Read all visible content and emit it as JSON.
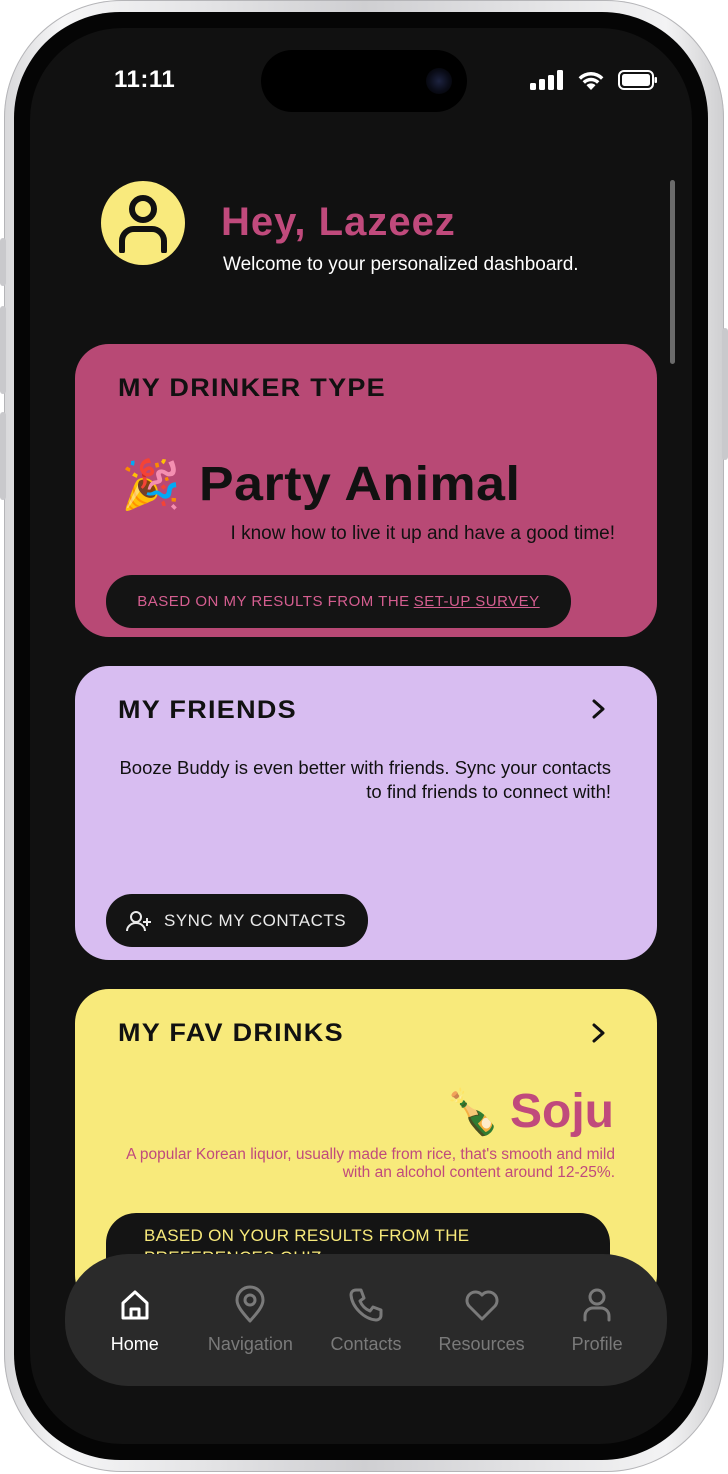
{
  "status_bar": {
    "time": "11:11"
  },
  "header": {
    "greeting": "Hey, Lazeez",
    "welcome": "Welcome to your personalized dashboard."
  },
  "drinker_card": {
    "title": "MY DRINKER TYPE",
    "type_emoji": "🎉",
    "type_name": "Party Animal",
    "description": "I know how to live it up and have a good time!",
    "survey_prefix": "BASED ON MY RESULTS FROM THE",
    "survey_link": "SET-UP SURVEY"
  },
  "friends_card": {
    "title": "MY FRIENDS",
    "description": "Booze Buddy is even better with friends. Sync your contacts to find friends to connect with!",
    "sync_label": "SYNC MY CONTACTS"
  },
  "drinks_card": {
    "title": "MY FAV DRINKS",
    "drink_emoji": "🍾",
    "drink_name": "Soju",
    "description": "A popular Korean liquor, usually made from rice, that's smooth and mild with an alcohol content around 12-25%.",
    "prefs_prefix": "BASED ON YOUR RESULTS FROM THE",
    "prefs_link": "PREFERENCES QUIZ"
  },
  "tab_bar": {
    "tabs": [
      {
        "label": "Home",
        "icon": "home-icon",
        "active": true
      },
      {
        "label": "Navigation",
        "icon": "location-pin-icon",
        "active": false
      },
      {
        "label": "Contacts",
        "icon": "phone-icon",
        "active": false
      },
      {
        "label": "Resources",
        "icon": "heart-icon",
        "active": false
      },
      {
        "label": "Profile",
        "icon": "person-icon",
        "active": false
      }
    ]
  },
  "colors": {
    "background": "#111111",
    "accent_pink": "#c04a7c",
    "card_pink": "#b84975",
    "card_lavender": "#d8bdf1",
    "card_yellow": "#f8ea7b",
    "avatar_yellow": "#f9ea7d",
    "tab_bar": "#2a2a2a"
  }
}
